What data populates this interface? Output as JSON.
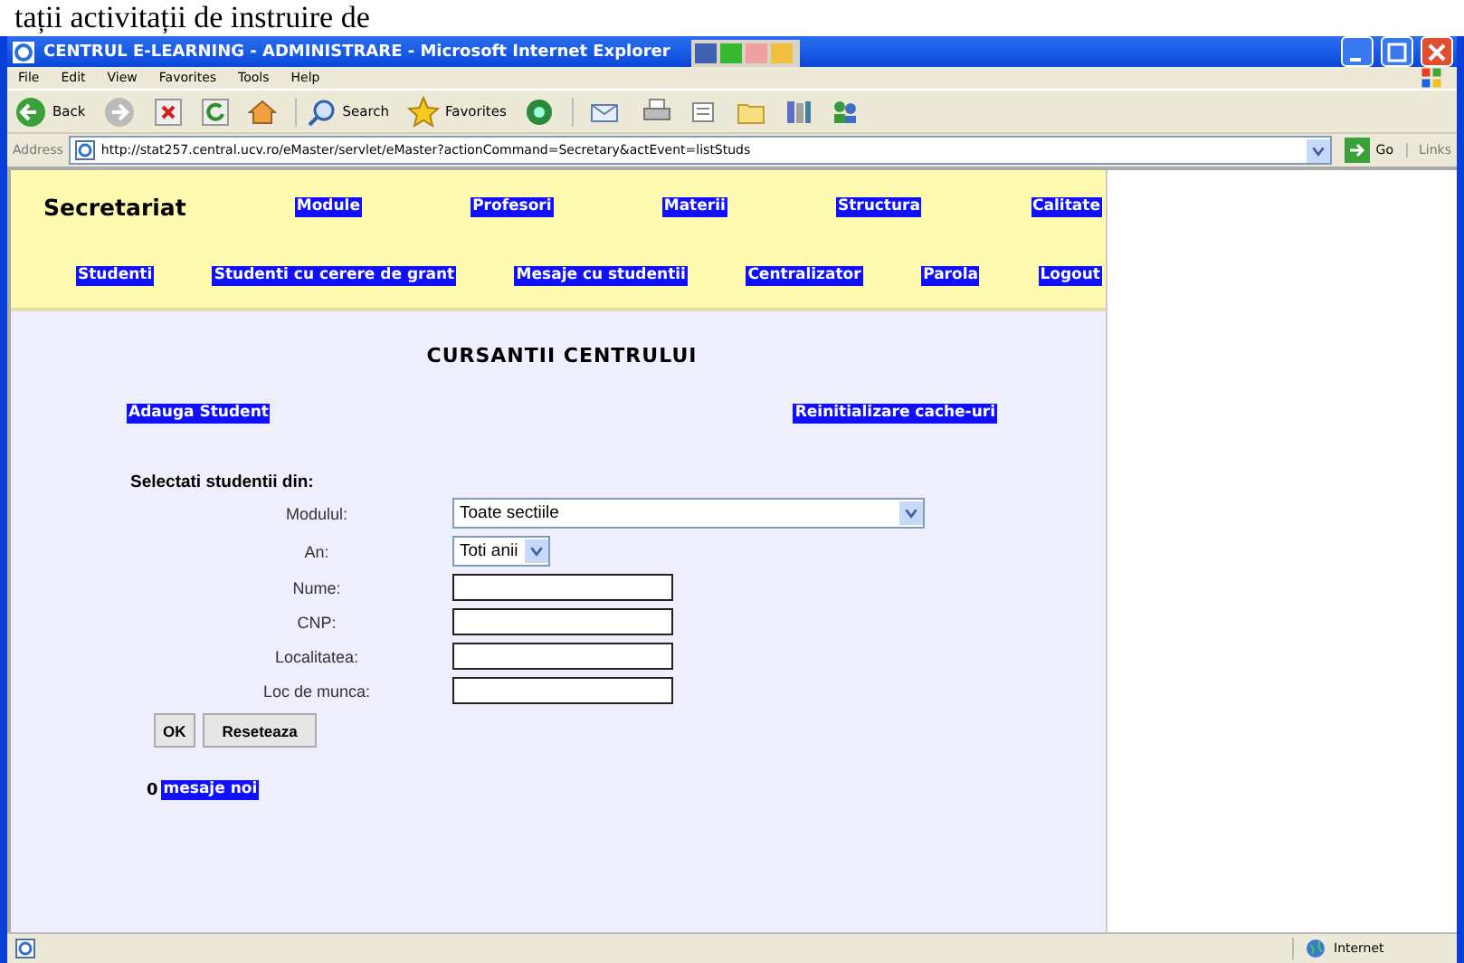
{
  "top_text": "tații activitații de instruire de",
  "window": {
    "title": "CENTRUL E-LEARNING - ADMINISTRARE - Microsoft Internet Explorer"
  },
  "menu_bar": [
    "File",
    "Edit",
    "View",
    "Favorites",
    "Tools",
    "Help"
  ],
  "toolbar": [
    {
      "kind": "back",
      "label": "Back"
    },
    {
      "kind": "forward"
    },
    {
      "kind": "stop"
    },
    {
      "kind": "refresh"
    },
    {
      "kind": "home"
    },
    {
      "kind": "search",
      "label": "Search"
    },
    {
      "kind": "favorites",
      "label": "Favorites"
    },
    {
      "kind": "media"
    },
    {
      "kind": "mail"
    },
    {
      "kind": "print"
    },
    {
      "kind": "edit"
    },
    {
      "kind": "folder"
    },
    {
      "kind": "research"
    },
    {
      "kind": "messenger"
    }
  ],
  "address_bar": {
    "label": "Address",
    "url": "http://stat257.central.ucv.ro/eMaster/servlet/eMaster?actionCommand=Secretary&actEvent=listStuds",
    "go": "Go",
    "links": "Links"
  },
  "page": {
    "brand": "Secretariat",
    "nav_row_1": [
      "Module",
      "Profesori",
      "Materii",
      "Structura",
      "Calitate"
    ],
    "nav_row_2": [
      "Studenti",
      "Studenti cu cerere de grant",
      "Mesaje cu studentii",
      "Centralizator",
      "Parola",
      "Logout"
    ],
    "heading": "CURSANTII CENTRULUI",
    "actions": [
      "Adauga Student",
      "Reinitializare cache-uri"
    ],
    "form": {
      "legend": "Selectati studentii din:",
      "fields": [
        {
          "kind": "select",
          "label": "Modulul:",
          "value": "Toate sectiile"
        },
        {
          "kind": "select-small",
          "label": "An:",
          "value": "Toti anii"
        },
        {
          "kind": "text",
          "label": "Nume:"
        },
        {
          "kind": "text",
          "label": "CNP:"
        },
        {
          "kind": "text",
          "label": "Localitatea:"
        },
        {
          "kind": "text",
          "label": "Loc de munca:"
        }
      ],
      "buttons": [
        "OK",
        "Reseteaza"
      ]
    },
    "messages": {
      "count": "0",
      "link": "mesaje noi"
    }
  },
  "status_bar": {
    "zone": "Internet"
  }
}
